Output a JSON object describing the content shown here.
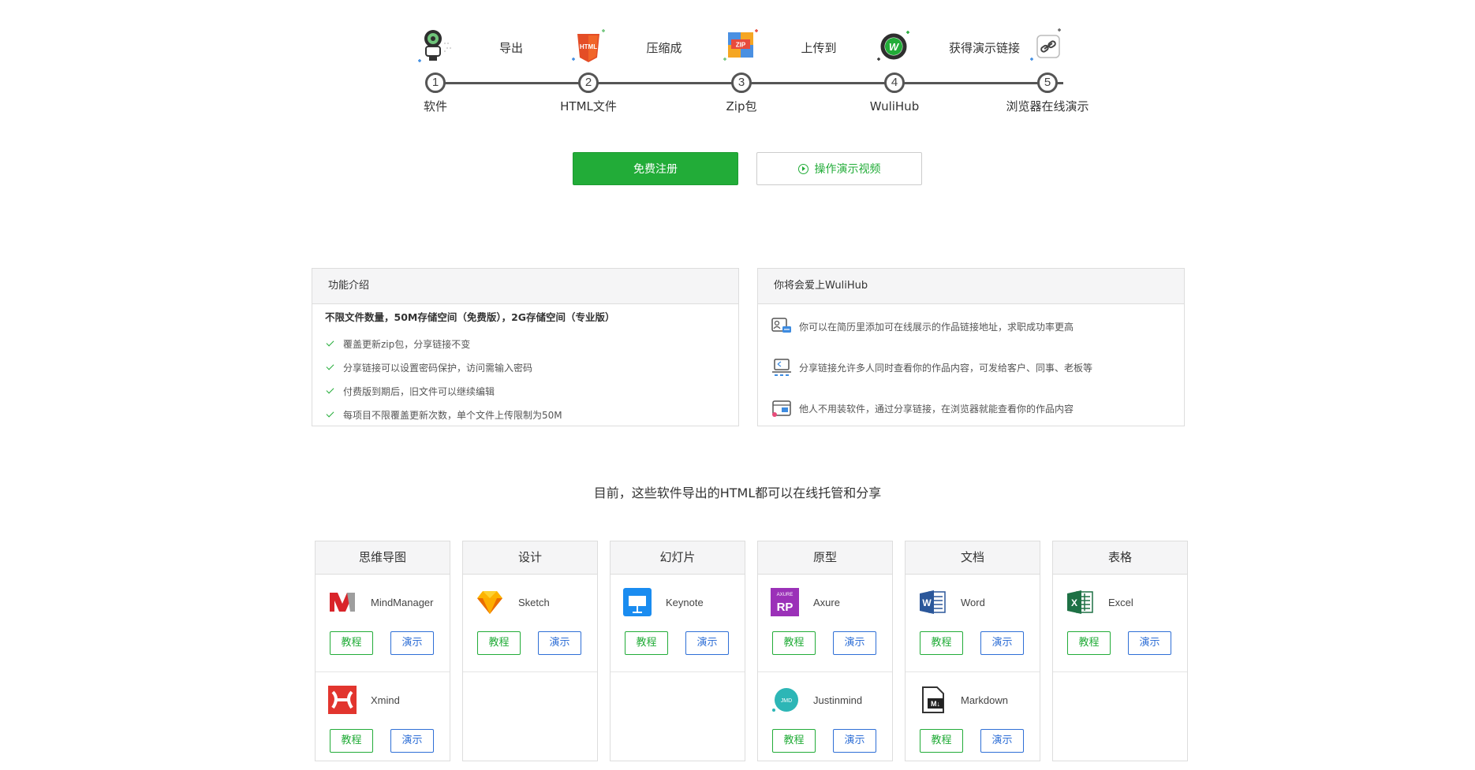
{
  "stepper": {
    "steps": [
      {
        "num": "1",
        "label": "软件"
      },
      {
        "num": "2",
        "label": "HTML文件"
      },
      {
        "num": "3",
        "label": "Zip包"
      },
      {
        "num": "4",
        "label": "WuliHub"
      },
      {
        "num": "5",
        "label": "浏览器在线演示"
      }
    ],
    "connectors": [
      "导出",
      "压缩成",
      "上传到",
      "获得演示链接"
    ],
    "icon_texts": {
      "html": "HTML",
      "zip": "ZIP",
      "wulihub": "W"
    }
  },
  "actions": {
    "register": "免费注册",
    "video": "操作演示视频"
  },
  "features": {
    "title": "功能介绍",
    "headline": "不限文件数量，50M存储空间（免费版），2G存储空间（专业版）",
    "items": [
      "覆盖更新zip包，分享链接不变",
      "分享链接可以设置密码保护，访问需输入密码",
      "付费版到期后，旧文件可以继续编辑",
      "每项目不限覆盖更新次数，单个文件上传限制为50M"
    ]
  },
  "love": {
    "title": "你将会爱上WuliHub",
    "items": [
      "你可以在简历里添加可在线展示的作品链接地址，求职成功率更高",
      "分享链接允许多人同时查看你的作品内容，可发给客户、同事、老板等",
      "他人不用装软件，通过分享链接，在浏览器就能查看你的作品内容"
    ]
  },
  "section_title": "目前，这些软件导出的HTML都可以在线托管和分享",
  "tutorial_label": "教程",
  "demo_label": "演示",
  "categories": [
    {
      "title": "思维导图",
      "apps": [
        "MindManager",
        "Xmind"
      ]
    },
    {
      "title": "设计",
      "apps": [
        "Sketch"
      ]
    },
    {
      "title": "幻灯片",
      "apps": [
        "Keynote"
      ]
    },
    {
      "title": "原型",
      "apps": [
        "Axure",
        "Justinmind"
      ]
    },
    {
      "title": "文档",
      "apps": [
        "Word",
        "Markdown"
      ]
    },
    {
      "title": "表格",
      "apps": [
        "Excel"
      ]
    }
  ],
  "app_icon_texts": {
    "axure_top": "AXURE",
    "axure": "RP",
    "justinmind": "JMD",
    "markdown": "M↓",
    "word": "W",
    "excel": "X"
  },
  "colors": {
    "accent_green": "#22ac38",
    "demo_blue": "#2f6fd6"
  }
}
